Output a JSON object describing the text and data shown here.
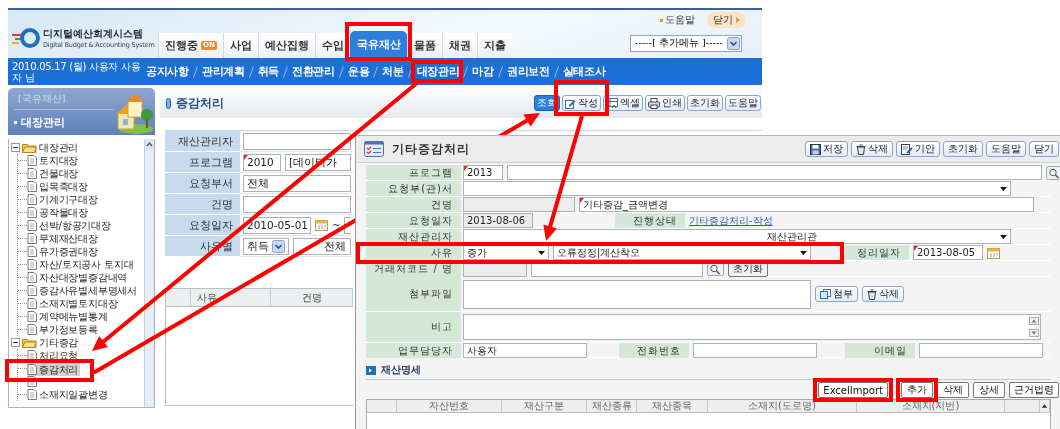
{
  "header": {
    "logo_title": "디지털예산회계시스템",
    "logo_subtitle": "Digital Budget & Accounting System",
    "links": [
      {
        "label": "도움말",
        "kind": "link"
      },
      {
        "label": "닫기",
        "kind": "close"
      }
    ],
    "tabs": [
      {
        "label": "진행중",
        "badge": "ON",
        "selected": false
      },
      {
        "label": "사업",
        "selected": false
      },
      {
        "label": "예산집행",
        "selected": false
      },
      {
        "label": "수입",
        "selected": false
      },
      {
        "label": "국유재산",
        "selected": true
      },
      {
        "label": "물품",
        "selected": false
      },
      {
        "label": "채권",
        "selected": false
      },
      {
        "label": "지출",
        "selected": false
      }
    ],
    "extra_menu": "-----[ 추가메뉴 ]-----"
  },
  "menu_bar": {
    "user_info": "2010.05.17 (월) 사용자 사용자 님",
    "items": [
      "공지사항",
      "관리계획",
      "취득",
      "전환관리",
      "운용",
      "처분",
      "대장관리",
      "마감",
      "권리보전",
      "실태조사"
    ]
  },
  "sidebar": {
    "section": "[국유재산]",
    "current": "대장관리",
    "tree": [
      {
        "label": "대장관리",
        "expanded": true,
        "children": [
          {
            "kind": "leaf",
            "label": "토지대장",
            "selected": false
          },
          {
            "kind": "leaf",
            "label": "건물대장",
            "selected": false
          },
          {
            "kind": "leaf",
            "label": "입목죽대장",
            "selected": false
          },
          {
            "kind": "leaf",
            "label": "기계기구대장",
            "selected": false
          },
          {
            "kind": "leaf",
            "label": "공작물대장",
            "selected": false
          },
          {
            "kind": "leaf",
            "label": "선박/항공기대장",
            "selected": false
          },
          {
            "kind": "leaf",
            "label": "무체재산대장",
            "selected": false
          },
          {
            "kind": "leaf",
            "label": "유가증권대장",
            "selected": false
          },
          {
            "kind": "leaf",
            "label": "자산/토지공사 토지대",
            "selected": false
          },
          {
            "kind": "leaf",
            "label": "자산대장별증감내역",
            "selected": false
          },
          {
            "kind": "leaf",
            "label": "증감사유별세부명세서",
            "selected": false
          },
          {
            "kind": "leaf",
            "label": "소재지별토지대장",
            "selected": false
          },
          {
            "kind": "leaf",
            "label": "계약메뉴별통계",
            "selected": false
          },
          {
            "kind": "leaf",
            "label": "부가정보등록",
            "selected": false
          }
        ]
      },
      {
        "label": "기타증감",
        "expanded": true,
        "children": [
          {
            "kind": "leaf",
            "label": "처리요청",
            "selected": false
          },
          {
            "kind": "leaf",
            "label": "증감처리",
            "selected": true
          },
          {
            "kind": "covered",
            "selected": false
          },
          {
            "kind": "leaf",
            "label": "소재지일괄변경",
            "selected": false
          }
        ]
      }
    ]
  },
  "page": {
    "title": "증감처리",
    "buttons": [
      {
        "label": "조회",
        "kind": "primary"
      },
      {
        "label": "작성",
        "kind": "edit"
      },
      {
        "label": "엑셀",
        "kind": "excel"
      },
      {
        "label": "인쇄",
        "kind": "print"
      },
      {
        "label": "초기화",
        "kind": "plain"
      },
      {
        "label": "도움말",
        "kind": "plain"
      }
    ],
    "search_form": [
      {
        "kind": "text",
        "label": "재산관리자",
        "required": false
      },
      {
        "kind": "program",
        "label": "프로그램",
        "code": "2010",
        "value": "[데이터가",
        "required": true
      },
      {
        "kind": "text",
        "label": "요청부서",
        "value": "전체",
        "required": false
      },
      {
        "kind": "text",
        "label": "건명",
        "required": false
      },
      {
        "kind": "date_range",
        "label": "요청일자",
        "value": "2010-05-01",
        "separator": "~",
        "required": false
      },
      {
        "kind": "reason",
        "label": "사유별",
        "type": "취득",
        "detail": "전체",
        "required": false
      }
    ],
    "grid_columns": [
      "사유",
      "건명"
    ]
  },
  "dialog": {
    "title": "기타증감처리",
    "buttons": [
      {
        "label": "저장",
        "kind": "save"
      },
      {
        "label": "삭제",
        "kind": "delete"
      },
      {
        "label": "기안",
        "kind": "draft"
      },
      {
        "label": "초기화",
        "kind": "plain"
      },
      {
        "label": "도움말",
        "kind": "plain"
      },
      {
        "label": "닫기",
        "kind": "plain"
      }
    ],
    "rows": [
      {
        "kind": "program",
        "label": "프로그램",
        "code": "2013",
        "required": true
      },
      {
        "kind": "select",
        "label": "요청부(관)서",
        "required": false
      },
      {
        "kind": "title",
        "label": "건명",
        "value": "기타증감_금액변경",
        "required": true
      },
      {
        "kind": "date_status",
        "label": "요청일자",
        "value": "2013-08-06",
        "status_label": "진행상태",
        "status": "기타증감처리-작성",
        "required": false
      },
      {
        "kind": "select",
        "label": "재산관리자",
        "value": "재산관리관",
        "required": false
      },
      {
        "kind": "reason",
        "label": "사유",
        "type": "증가",
        "detail": "오류정정|계산착오",
        "date_label": "정리일자",
        "date": "2013-08-05",
        "required": true
      },
      {
        "kind": "client",
        "label": "거래처코드 / 명",
        "button": "초기화",
        "required": false
      },
      {
        "kind": "attach",
        "label": "첨부파일",
        "buttons": [
          "첨부",
          "삭제"
        ],
        "required": false
      },
      {
        "kind": "memo",
        "label": "비고",
        "required": false
      },
      {
        "kind": "contact",
        "label": "업무담당자",
        "value": "사용자",
        "phone_label": "전화번호",
        "email_label": "이메일",
        "required": false
      }
    ],
    "section": "재산명세",
    "grid_buttons": [
      "ExcelImport",
      "추가",
      "삭제",
      "상세",
      "근거법령"
    ],
    "grid_columns": [
      "자산번호",
      "재산구분",
      "재산종류",
      "재산종목",
      "소재지(도로명)",
      "소재지(지번)"
    ]
  }
}
